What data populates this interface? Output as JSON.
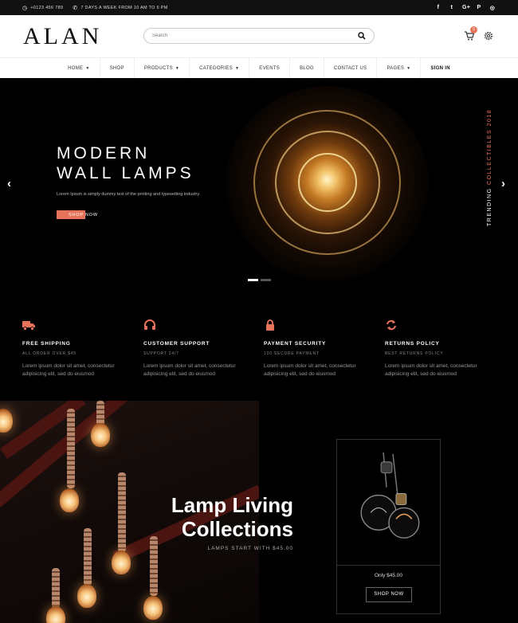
{
  "topbar": {
    "phone": "+0123 456 789",
    "hours": "7 DAYS A WEEK FROM 10 AM TO 6 PM",
    "social": [
      {
        "icon": "facebook-icon",
        "glyph": "f"
      },
      {
        "icon": "twitter-icon",
        "glyph": "t"
      },
      {
        "icon": "google-plus-icon",
        "glyph": "G+"
      },
      {
        "icon": "pinterest-icon",
        "glyph": "P"
      },
      {
        "icon": "instagram-icon",
        "glyph": "◎"
      }
    ]
  },
  "header": {
    "logo": "ALAN",
    "search_placeholder": "Search",
    "cart_count": "0"
  },
  "nav": {
    "items": [
      {
        "label": "HOME",
        "dropdown": true
      },
      {
        "label": "SHOP",
        "dropdown": false
      },
      {
        "label": "PRODUCTS",
        "dropdown": true
      },
      {
        "label": "CATEGORIES",
        "dropdown": true
      },
      {
        "label": "EVENTS",
        "dropdown": false
      },
      {
        "label": "BLOG",
        "dropdown": false
      },
      {
        "label": "CONTACT US",
        "dropdown": false
      },
      {
        "label": "PAGES",
        "dropdown": true
      },
      {
        "label": "SIGN IN",
        "dropdown": false
      }
    ]
  },
  "hero": {
    "title_line1": "MODERN",
    "title_line2": "WALL LAMPS",
    "subtitle": "Lorem Ipsum is simply dummy text of the printing and typesetting industry.",
    "cta": "SHOP NOW",
    "side_text": "TRENDING",
    "side_text_accent": "COLLECTIBLES 2018",
    "slides_total": 2,
    "slide_active": 1
  },
  "features": [
    {
      "icon": "truck-icon",
      "title": "FREE SHIPPING",
      "sub": "ALL ORDER OVER $45",
      "desc": "Lorem ipsum dolor sit amet, consectetur adipisicing elit, sed do eiusmod"
    },
    {
      "icon": "headphones-icon",
      "title": "CUSTOMER SUPPORT",
      "sub": "SUPPORT 24/7",
      "desc": "Lorem ipsum dolor sit amet, consectetur adipisicing elit, sed do eiusmod"
    },
    {
      "icon": "lock-icon",
      "title": "PAYMENT SECURITY",
      "sub": "100 SECURE PAYMENT",
      "desc": "Lorem ipsum dolor sit amet, consectetur adipisicing elit, sed do eiusmod"
    },
    {
      "icon": "refresh-icon",
      "title": "RETURNS POLICY",
      "sub": "BEST RETURNS POLICY",
      "desc": "Lorem ipsum dolor sit amet, consectetur adipisicing elit, sed do eiusmod"
    }
  ],
  "collection": {
    "title_line1": "Lamp Living",
    "title_line2": "Collections",
    "sub": "LAMPS START WITH $45.00"
  },
  "product_card": {
    "price": "Only $45.00",
    "cta": "SHOP NOW"
  },
  "colors": {
    "accent": "#e8735b",
    "background": "#000000",
    "header_bg": "#ffffff"
  }
}
